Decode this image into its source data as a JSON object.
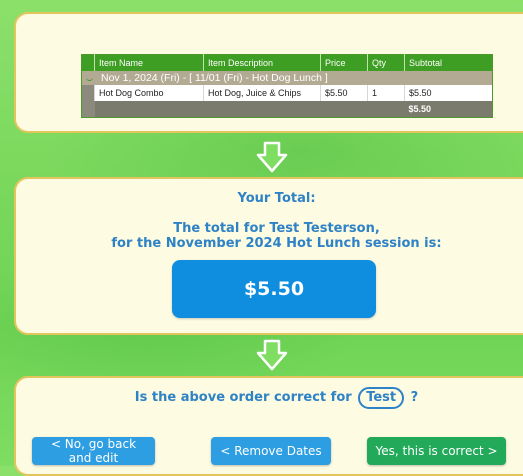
{
  "order_table": {
    "headers": [
      "Item Name",
      "Item Description",
      "Price",
      "Qty",
      "Subtotal"
    ],
    "group_label": "Nov 1, 2024 (Fri) - [ 11/01 (Fri) - Hot Dog Lunch ]",
    "items": [
      {
        "name": "Hot Dog Combo",
        "description": "Hot Dog, Juice & Chips",
        "price": "$5.50",
        "qty": "1",
        "subtotal": "$5.50"
      }
    ],
    "total": "$5.50"
  },
  "summary": {
    "heading": "Your Total:",
    "line1": "The total for Test Testerson,",
    "line2": "for the November 2024 Hot Lunch session is:",
    "amount": "$5.50"
  },
  "confirm": {
    "question_prefix": "Is the above order correct for",
    "name": "Test",
    "question_suffix": "?",
    "buttons": {
      "back": "< No, go back and edit",
      "remove": "< Remove Dates",
      "yes": "Yes, this is correct >"
    }
  },
  "colors": {
    "background": "#7ad85c",
    "card": "#fdfbe1",
    "card_border": "#e2c65c",
    "table_header": "#3e9d23",
    "text_blue": "#2e82c6",
    "amount_box": "#0f8ee0",
    "button_blue": "#2d9ee2",
    "button_green": "#22a95a"
  },
  "icons": [
    "down-arrow-icon"
  ]
}
